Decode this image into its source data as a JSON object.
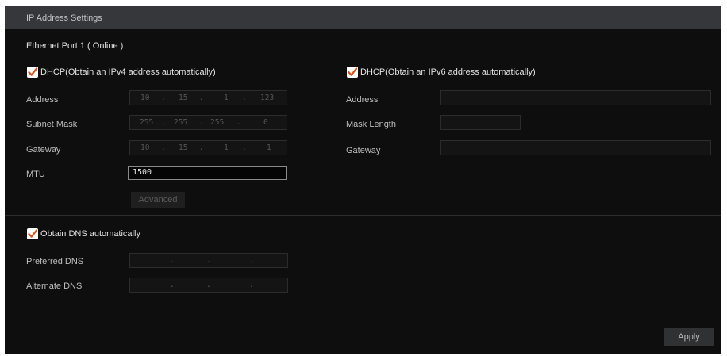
{
  "title": "IP Address Settings",
  "port_label": "Ethernet Port 1 ( Online )",
  "ipv4": {
    "dhcp_label": "DHCP(Obtain an IPv4 address automatically)",
    "dhcp_checked": true,
    "address_label": "Address",
    "address": [
      "10",
      ".",
      "15",
      ".",
      "1",
      ".",
      "123"
    ],
    "subnet_label": "Subnet Mask",
    "subnet": [
      "255",
      ".",
      "255",
      ".",
      "255",
      ".",
      "0"
    ],
    "gateway_label": "Gateway",
    "gateway": [
      "10",
      ".",
      "15",
      ".",
      "1",
      ".",
      "1"
    ],
    "mtu_label": "MTU",
    "mtu_value": "1500",
    "advanced_label": "Advanced"
  },
  "ipv6": {
    "dhcp_label": "DHCP(Obtain an IPv6 address automatically)",
    "dhcp_checked": true,
    "address_label": "Address",
    "mask_length_label": "Mask Length",
    "gateway_label": "Gateway"
  },
  "dns": {
    "auto_label": "Obtain DNS automatically",
    "auto_checked": true,
    "preferred_label": "Preferred DNS",
    "preferred_dots": [
      ".",
      ".",
      "."
    ],
    "alternate_label": "Alternate DNS",
    "alternate_dots": [
      ".",
      ".",
      "."
    ]
  },
  "apply_label": "Apply",
  "colors": {
    "checkbox_accent": "#e8501a",
    "panel_bg": "#0e0e0e",
    "titlebar_bg": "#35373b"
  }
}
